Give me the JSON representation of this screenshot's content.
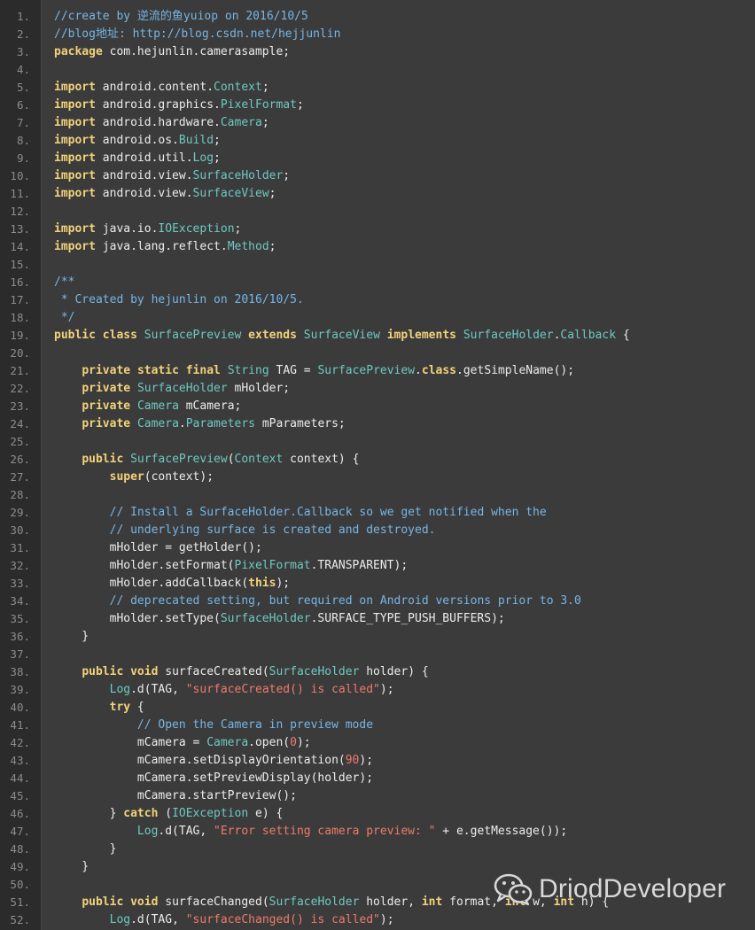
{
  "watermark": {
    "text": "DriodDeveloper",
    "icon": "wechat-icon"
  },
  "code_lines": [
    {
      "n": "1.",
      "tokens": [
        {
          "t": "//create by 逆流的鱼yuiop on 2016/10/5",
          "c": "com"
        }
      ]
    },
    {
      "n": "2.",
      "tokens": [
        {
          "t": "//blog地址: http://blog.csdn.net/hejjunlin",
          "c": "com"
        }
      ]
    },
    {
      "n": "3.",
      "tokens": [
        {
          "t": "package",
          "c": "kw"
        },
        {
          "t": " com.hejunlin.camerasample;",
          "c": "plain"
        }
      ]
    },
    {
      "n": "4.",
      "tokens": []
    },
    {
      "n": "5.",
      "tokens": [
        {
          "t": "import",
          "c": "kw"
        },
        {
          "t": " android.content.",
          "c": "plain"
        },
        {
          "t": "Context",
          "c": "type"
        },
        {
          "t": ";",
          "c": "plain"
        }
      ]
    },
    {
      "n": "6.",
      "tokens": [
        {
          "t": "import",
          "c": "kw"
        },
        {
          "t": " android.graphics.",
          "c": "plain"
        },
        {
          "t": "PixelFormat",
          "c": "type"
        },
        {
          "t": ";",
          "c": "plain"
        }
      ]
    },
    {
      "n": "7.",
      "tokens": [
        {
          "t": "import",
          "c": "kw"
        },
        {
          "t": " android.hardware.",
          "c": "plain"
        },
        {
          "t": "Camera",
          "c": "type"
        },
        {
          "t": ";",
          "c": "plain"
        }
      ]
    },
    {
      "n": "8.",
      "tokens": [
        {
          "t": "import",
          "c": "kw"
        },
        {
          "t": " android.os.",
          "c": "plain"
        },
        {
          "t": "Build",
          "c": "type"
        },
        {
          "t": ";",
          "c": "plain"
        }
      ]
    },
    {
      "n": "9.",
      "tokens": [
        {
          "t": "import",
          "c": "kw"
        },
        {
          "t": " android.util.",
          "c": "plain"
        },
        {
          "t": "Log",
          "c": "type"
        },
        {
          "t": ";",
          "c": "plain"
        }
      ]
    },
    {
      "n": "10.",
      "tokens": [
        {
          "t": "import",
          "c": "kw"
        },
        {
          "t": " android.view.",
          "c": "plain"
        },
        {
          "t": "SurfaceHolder",
          "c": "type"
        },
        {
          "t": ";",
          "c": "plain"
        }
      ]
    },
    {
      "n": "11.",
      "tokens": [
        {
          "t": "import",
          "c": "kw"
        },
        {
          "t": " android.view.",
          "c": "plain"
        },
        {
          "t": "SurfaceView",
          "c": "type"
        },
        {
          "t": ";",
          "c": "plain"
        }
      ]
    },
    {
      "n": "12.",
      "tokens": []
    },
    {
      "n": "13.",
      "tokens": [
        {
          "t": "import",
          "c": "kw"
        },
        {
          "t": " java.io.",
          "c": "plain"
        },
        {
          "t": "IOException",
          "c": "type"
        },
        {
          "t": ";",
          "c": "plain"
        }
      ]
    },
    {
      "n": "14.",
      "tokens": [
        {
          "t": "import",
          "c": "kw"
        },
        {
          "t": " java.lang.reflect.",
          "c": "plain"
        },
        {
          "t": "Method",
          "c": "type"
        },
        {
          "t": ";",
          "c": "plain"
        }
      ]
    },
    {
      "n": "15.",
      "tokens": []
    },
    {
      "n": "16.",
      "tokens": [
        {
          "t": "/**",
          "c": "com"
        }
      ]
    },
    {
      "n": "17.",
      "tokens": [
        {
          "t": " * Created by hejunlin on 2016/10/5.",
          "c": "com"
        }
      ]
    },
    {
      "n": "18.",
      "tokens": [
        {
          "t": " */",
          "c": "com"
        }
      ]
    },
    {
      "n": "19.",
      "tokens": [
        {
          "t": "public",
          "c": "kw"
        },
        {
          "t": " ",
          "c": "plain"
        },
        {
          "t": "class",
          "c": "kw"
        },
        {
          "t": " ",
          "c": "plain"
        },
        {
          "t": "SurfacePreview",
          "c": "type"
        },
        {
          "t": " ",
          "c": "plain"
        },
        {
          "t": "extends",
          "c": "kw"
        },
        {
          "t": " ",
          "c": "plain"
        },
        {
          "t": "SurfaceView",
          "c": "type"
        },
        {
          "t": " ",
          "c": "plain"
        },
        {
          "t": "implements",
          "c": "kw"
        },
        {
          "t": " ",
          "c": "plain"
        },
        {
          "t": "SurfaceHolder",
          "c": "type"
        },
        {
          "t": ".",
          "c": "plain"
        },
        {
          "t": "Callback",
          "c": "type"
        },
        {
          "t": " {",
          "c": "plain"
        }
      ]
    },
    {
      "n": "20.",
      "tokens": []
    },
    {
      "n": "21.",
      "tokens": [
        {
          "t": "    ",
          "c": "plain"
        },
        {
          "t": "private",
          "c": "kw"
        },
        {
          "t": " ",
          "c": "plain"
        },
        {
          "t": "static",
          "c": "kw"
        },
        {
          "t": " ",
          "c": "plain"
        },
        {
          "t": "final",
          "c": "kw"
        },
        {
          "t": " ",
          "c": "plain"
        },
        {
          "t": "String",
          "c": "type"
        },
        {
          "t": " TAG = ",
          "c": "plain"
        },
        {
          "t": "SurfacePreview",
          "c": "type"
        },
        {
          "t": ".",
          "c": "plain"
        },
        {
          "t": "class",
          "c": "kw"
        },
        {
          "t": ".getSimpleName();",
          "c": "plain"
        }
      ]
    },
    {
      "n": "22.",
      "tokens": [
        {
          "t": "    ",
          "c": "plain"
        },
        {
          "t": "private",
          "c": "kw"
        },
        {
          "t": " ",
          "c": "plain"
        },
        {
          "t": "SurfaceHolder",
          "c": "type"
        },
        {
          "t": " mHolder;",
          "c": "plain"
        }
      ]
    },
    {
      "n": "23.",
      "tokens": [
        {
          "t": "    ",
          "c": "plain"
        },
        {
          "t": "private",
          "c": "kw"
        },
        {
          "t": " ",
          "c": "plain"
        },
        {
          "t": "Camera",
          "c": "type"
        },
        {
          "t": " mCamera;",
          "c": "plain"
        }
      ]
    },
    {
      "n": "24.",
      "tokens": [
        {
          "t": "    ",
          "c": "plain"
        },
        {
          "t": "private",
          "c": "kw"
        },
        {
          "t": " ",
          "c": "plain"
        },
        {
          "t": "Camera",
          "c": "type"
        },
        {
          "t": ".",
          "c": "plain"
        },
        {
          "t": "Parameters",
          "c": "type"
        },
        {
          "t": " mParameters;",
          "c": "plain"
        }
      ]
    },
    {
      "n": "25.",
      "tokens": []
    },
    {
      "n": "26.",
      "tokens": [
        {
          "t": "    ",
          "c": "plain"
        },
        {
          "t": "public",
          "c": "kw"
        },
        {
          "t": " ",
          "c": "plain"
        },
        {
          "t": "SurfacePreview",
          "c": "type"
        },
        {
          "t": "(",
          "c": "plain"
        },
        {
          "t": "Context",
          "c": "type"
        },
        {
          "t": " context) {",
          "c": "plain"
        }
      ]
    },
    {
      "n": "27.",
      "tokens": [
        {
          "t": "        ",
          "c": "plain"
        },
        {
          "t": "super",
          "c": "kw"
        },
        {
          "t": "(context);",
          "c": "plain"
        }
      ]
    },
    {
      "n": "28.",
      "tokens": []
    },
    {
      "n": "29.",
      "tokens": [
        {
          "t": "        ",
          "c": "plain"
        },
        {
          "t": "// Install a SurfaceHolder.Callback so we get notified when the",
          "c": "com"
        }
      ]
    },
    {
      "n": "30.",
      "tokens": [
        {
          "t": "        ",
          "c": "plain"
        },
        {
          "t": "// underlying surface is created and destroyed.",
          "c": "com"
        }
      ]
    },
    {
      "n": "31.",
      "tokens": [
        {
          "t": "        mHolder = getHolder();",
          "c": "plain"
        }
      ]
    },
    {
      "n": "32.",
      "tokens": [
        {
          "t": "        mHolder.setFormat(",
          "c": "plain"
        },
        {
          "t": "PixelFormat",
          "c": "type"
        },
        {
          "t": ".TRANSPARENT);",
          "c": "plain"
        }
      ]
    },
    {
      "n": "33.",
      "tokens": [
        {
          "t": "        mHolder.addCallback(",
          "c": "plain"
        },
        {
          "t": "this",
          "c": "kw"
        },
        {
          "t": ");",
          "c": "plain"
        }
      ]
    },
    {
      "n": "34.",
      "tokens": [
        {
          "t": "        ",
          "c": "plain"
        },
        {
          "t": "// deprecated setting, but required on Android versions prior to 3.0",
          "c": "com"
        }
      ]
    },
    {
      "n": "35.",
      "tokens": [
        {
          "t": "        mHolder.setType(",
          "c": "plain"
        },
        {
          "t": "SurfaceHolder",
          "c": "type"
        },
        {
          "t": ".SURFACE_TYPE_PUSH_BUFFERS);",
          "c": "plain"
        }
      ]
    },
    {
      "n": "36.",
      "tokens": [
        {
          "t": "    }",
          "c": "plain"
        }
      ]
    },
    {
      "n": "37.",
      "tokens": []
    },
    {
      "n": "38.",
      "tokens": [
        {
          "t": "    ",
          "c": "plain"
        },
        {
          "t": "public",
          "c": "kw"
        },
        {
          "t": " ",
          "c": "plain"
        },
        {
          "t": "void",
          "c": "kw"
        },
        {
          "t": " surfaceCreated(",
          "c": "plain"
        },
        {
          "t": "SurfaceHolder",
          "c": "type"
        },
        {
          "t": " holder) {",
          "c": "plain"
        }
      ]
    },
    {
      "n": "39.",
      "tokens": [
        {
          "t": "        ",
          "c": "plain"
        },
        {
          "t": "Log",
          "c": "type"
        },
        {
          "t": ".d(TAG, ",
          "c": "plain"
        },
        {
          "t": "\"surfaceCreated() is called\"",
          "c": "str"
        },
        {
          "t": ");",
          "c": "plain"
        }
      ]
    },
    {
      "n": "40.",
      "tokens": [
        {
          "t": "        ",
          "c": "plain"
        },
        {
          "t": "try",
          "c": "kw"
        },
        {
          "t": " {",
          "c": "plain"
        }
      ]
    },
    {
      "n": "41.",
      "tokens": [
        {
          "t": "            ",
          "c": "plain"
        },
        {
          "t": "// Open the Camera in preview mode",
          "c": "com"
        }
      ]
    },
    {
      "n": "42.",
      "tokens": [
        {
          "t": "            mCamera = ",
          "c": "plain"
        },
        {
          "t": "Camera",
          "c": "type"
        },
        {
          "t": ".open(",
          "c": "plain"
        },
        {
          "t": "0",
          "c": "num"
        },
        {
          "t": ");",
          "c": "plain"
        }
      ]
    },
    {
      "n": "43.",
      "tokens": [
        {
          "t": "            mCamera.setDisplayOrientation(",
          "c": "plain"
        },
        {
          "t": "90",
          "c": "num"
        },
        {
          "t": ");",
          "c": "plain"
        }
      ]
    },
    {
      "n": "44.",
      "tokens": [
        {
          "t": "            mCamera.setPreviewDisplay(holder);",
          "c": "plain"
        }
      ]
    },
    {
      "n": "45.",
      "tokens": [
        {
          "t": "            mCamera.startPreview();",
          "c": "plain"
        }
      ]
    },
    {
      "n": "46.",
      "tokens": [
        {
          "t": "        } ",
          "c": "plain"
        },
        {
          "t": "catch",
          "c": "kw"
        },
        {
          "t": " (",
          "c": "plain"
        },
        {
          "t": "IOException",
          "c": "type"
        },
        {
          "t": " e) {",
          "c": "plain"
        }
      ]
    },
    {
      "n": "47.",
      "tokens": [
        {
          "t": "            ",
          "c": "plain"
        },
        {
          "t": "Log",
          "c": "type"
        },
        {
          "t": ".d(TAG, ",
          "c": "plain"
        },
        {
          "t": "\"Error setting camera preview: \"",
          "c": "str"
        },
        {
          "t": " + e.getMessage());",
          "c": "plain"
        }
      ]
    },
    {
      "n": "48.",
      "tokens": [
        {
          "t": "        }",
          "c": "plain"
        }
      ]
    },
    {
      "n": "49.",
      "tokens": [
        {
          "t": "    }",
          "c": "plain"
        }
      ]
    },
    {
      "n": "50.",
      "tokens": []
    },
    {
      "n": "51.",
      "tokens": [
        {
          "t": "    ",
          "c": "plain"
        },
        {
          "t": "public",
          "c": "kw"
        },
        {
          "t": " ",
          "c": "plain"
        },
        {
          "t": "void",
          "c": "kw"
        },
        {
          "t": " surfaceChanged(",
          "c": "plain"
        },
        {
          "t": "SurfaceHolder",
          "c": "type"
        },
        {
          "t": " holder, ",
          "c": "plain"
        },
        {
          "t": "int",
          "c": "kw"
        },
        {
          "t": " format, ",
          "c": "plain"
        },
        {
          "t": "int",
          "c": "kw"
        },
        {
          "t": " w, ",
          "c": "plain"
        },
        {
          "t": "int",
          "c": "kw"
        },
        {
          "t": " h) {",
          "c": "plain"
        }
      ]
    },
    {
      "n": "52.",
      "tokens": [
        {
          "t": "        ",
          "c": "plain"
        },
        {
          "t": "Log",
          "c": "type"
        },
        {
          "t": ".d(TAG, ",
          "c": "plain"
        },
        {
          "t": "\"surfaceChanged() is called\"",
          "c": "str"
        },
        {
          "t": ");",
          "c": "plain"
        }
      ]
    }
  ]
}
